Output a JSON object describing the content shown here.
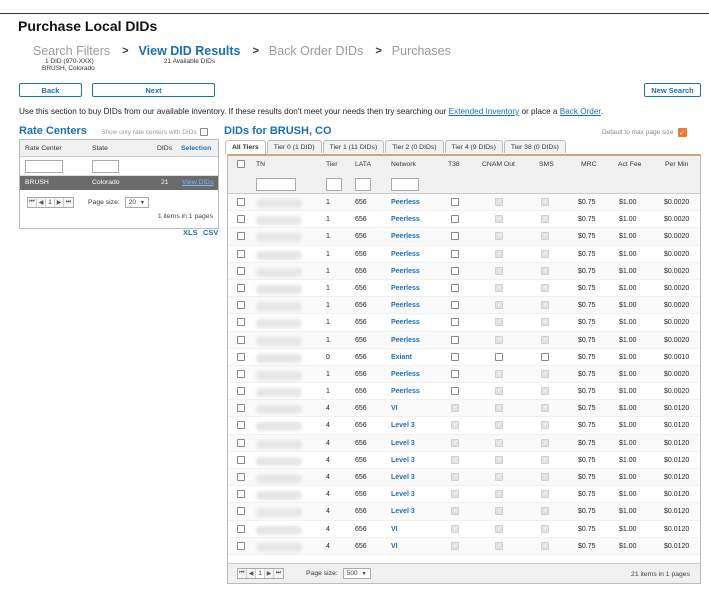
{
  "title": "Purchase Local DIDs",
  "steps": [
    {
      "label": "Search Filters",
      "sub1": "1 DID (970-XXX)",
      "sub2": "BRUSH, Colorado"
    },
    {
      "label": "View DID Results",
      "sub1": "21 Available DIDs"
    },
    {
      "label": "Back Order DIDs",
      "sub1": ""
    },
    {
      "label": "Purchases",
      "sub1": "-"
    }
  ],
  "step_arrow": ">",
  "buttons": {
    "back": "Back",
    "next": "Next",
    "new_search": "New Search"
  },
  "intro": {
    "pre": "Use this section to buy DIDs from our available inventory. If these results don't meet your needs then try searching our ",
    "link1": "Extended Inventory",
    "mid": " or place a ",
    "link2": "Back Order",
    "post": "."
  },
  "rate_centers": {
    "title": "Rate Centers",
    "only_label": "Show only rate centers with DIDs",
    "headers": {
      "rate_center": "Rate Center",
      "state": "State",
      "dids": "DIDs",
      "selection": "Selection"
    },
    "row": {
      "rate_center": "BRUSH",
      "state": "Colorado",
      "dids": "21",
      "view": "View DIDs"
    },
    "pager": {
      "page": "1",
      "size_label": "Page size:",
      "size": "20",
      "items": "1 items in 1 pages"
    },
    "xls": "XLS",
    "csv": "CSV"
  },
  "dids": {
    "title": "DIDs for BRUSH, CO",
    "default_max": "Default to max page size",
    "tabs": [
      "All Tiers",
      "Tier 0 (1 DID)",
      "Tier 1 (11 DIDs)",
      "Tier 2 (0 DIDs)",
      "Tier 4 (9 DIDs)",
      "Tier 38 (0 DIDs)"
    ],
    "headers": {
      "tn": "TN",
      "tier": "Tier",
      "lata": "LATA",
      "network": "Network",
      "t38": "T38",
      "cnam": "CNAM Out",
      "sms": "SMS",
      "mrc": "MRC",
      "act": "Act Fee",
      "permin": "Per Min"
    },
    "rows": [
      {
        "tier": "1",
        "lata": "656",
        "network": "Peerless",
        "t38": false,
        "cnam": true,
        "sms": true,
        "mrc": "$0.75",
        "act": "$1.00",
        "permin": "$0.0020"
      },
      {
        "tier": "1",
        "lata": "656",
        "network": "Peerless",
        "t38": false,
        "cnam": true,
        "sms": true,
        "mrc": "$0.75",
        "act": "$1.00",
        "permin": "$0.0020"
      },
      {
        "tier": "1",
        "lata": "656",
        "network": "Peerless",
        "t38": false,
        "cnam": true,
        "sms": true,
        "mrc": "$0.75",
        "act": "$1.00",
        "permin": "$0.0020"
      },
      {
        "tier": "1",
        "lata": "656",
        "network": "Peerless",
        "t38": false,
        "cnam": true,
        "sms": true,
        "mrc": "$0.75",
        "act": "$1.00",
        "permin": "$0.0020"
      },
      {
        "tier": "1",
        "lata": "656",
        "network": "Peerless",
        "t38": false,
        "cnam": true,
        "sms": true,
        "mrc": "$0.75",
        "act": "$1.00",
        "permin": "$0.0020"
      },
      {
        "tier": "1",
        "lata": "656",
        "network": "Peerless",
        "t38": false,
        "cnam": true,
        "sms": true,
        "mrc": "$0.75",
        "act": "$1.00",
        "permin": "$0.0020"
      },
      {
        "tier": "1",
        "lata": "656",
        "network": "Peerless",
        "t38": false,
        "cnam": true,
        "sms": true,
        "mrc": "$0.75",
        "act": "$1.00",
        "permin": "$0.0020"
      },
      {
        "tier": "1",
        "lata": "656",
        "network": "Peerless",
        "t38": false,
        "cnam": true,
        "sms": true,
        "mrc": "$0.75",
        "act": "$1.00",
        "permin": "$0.0020"
      },
      {
        "tier": "1",
        "lata": "656",
        "network": "Peerless",
        "t38": false,
        "cnam": true,
        "sms": true,
        "mrc": "$0.75",
        "act": "$1.00",
        "permin": "$0.0020"
      },
      {
        "tier": "0",
        "lata": "656",
        "network": "Exiant",
        "t38": false,
        "cnam": false,
        "sms": false,
        "mrc": "$0.75",
        "act": "$1.00",
        "permin": "$0.0010"
      },
      {
        "tier": "1",
        "lata": "656",
        "network": "Peerless",
        "t38": false,
        "cnam": true,
        "sms": true,
        "mrc": "$0.75",
        "act": "$1.00",
        "permin": "$0.0020"
      },
      {
        "tier": "1",
        "lata": "656",
        "network": "Peerless",
        "t38": false,
        "cnam": true,
        "sms": true,
        "mrc": "$0.75",
        "act": "$1.00",
        "permin": "$0.0020"
      },
      {
        "tier": "4",
        "lata": "656",
        "network": "VI",
        "t38": true,
        "cnam": true,
        "sms": true,
        "mrc": "$0.75",
        "act": "$1.00",
        "permin": "$0.0120"
      },
      {
        "tier": "4",
        "lata": "656",
        "network": "Level 3",
        "t38": true,
        "cnam": true,
        "sms": true,
        "mrc": "$0.75",
        "act": "$1.00",
        "permin": "$0.0120"
      },
      {
        "tier": "4",
        "lata": "656",
        "network": "Level 3",
        "t38": true,
        "cnam": true,
        "sms": true,
        "mrc": "$0.75",
        "act": "$1.00",
        "permin": "$0.0120"
      },
      {
        "tier": "4",
        "lata": "656",
        "network": "Level 3",
        "t38": true,
        "cnam": true,
        "sms": true,
        "mrc": "$0.75",
        "act": "$1.00",
        "permin": "$0.0120"
      },
      {
        "tier": "4",
        "lata": "656",
        "network": "Level 3",
        "t38": true,
        "cnam": true,
        "sms": true,
        "mrc": "$0.75",
        "act": "$1.00",
        "permin": "$0.0120"
      },
      {
        "tier": "4",
        "lata": "656",
        "network": "Level 3",
        "t38": true,
        "cnam": true,
        "sms": true,
        "mrc": "$0.75",
        "act": "$1.00",
        "permin": "$0.0120"
      },
      {
        "tier": "4",
        "lata": "656",
        "network": "Level 3",
        "t38": true,
        "cnam": true,
        "sms": true,
        "mrc": "$0.75",
        "act": "$1.00",
        "permin": "$0.0120"
      },
      {
        "tier": "4",
        "lata": "656",
        "network": "VI",
        "t38": true,
        "cnam": true,
        "sms": true,
        "mrc": "$0.75",
        "act": "$1.00",
        "permin": "$0.0120"
      },
      {
        "tier": "4",
        "lata": "656",
        "network": "VI",
        "t38": true,
        "cnam": true,
        "sms": true,
        "mrc": "$0.75",
        "act": "$1.00",
        "permin": "$0.0120"
      }
    ],
    "pager": {
      "page": "1",
      "size_label": "Page size:",
      "size": "500",
      "items": "21 items in 1 pages"
    }
  },
  "colors": {
    "brand": "#1a6fb7",
    "accent": "#f07a2c",
    "selected_row": "#6b6b6b"
  }
}
